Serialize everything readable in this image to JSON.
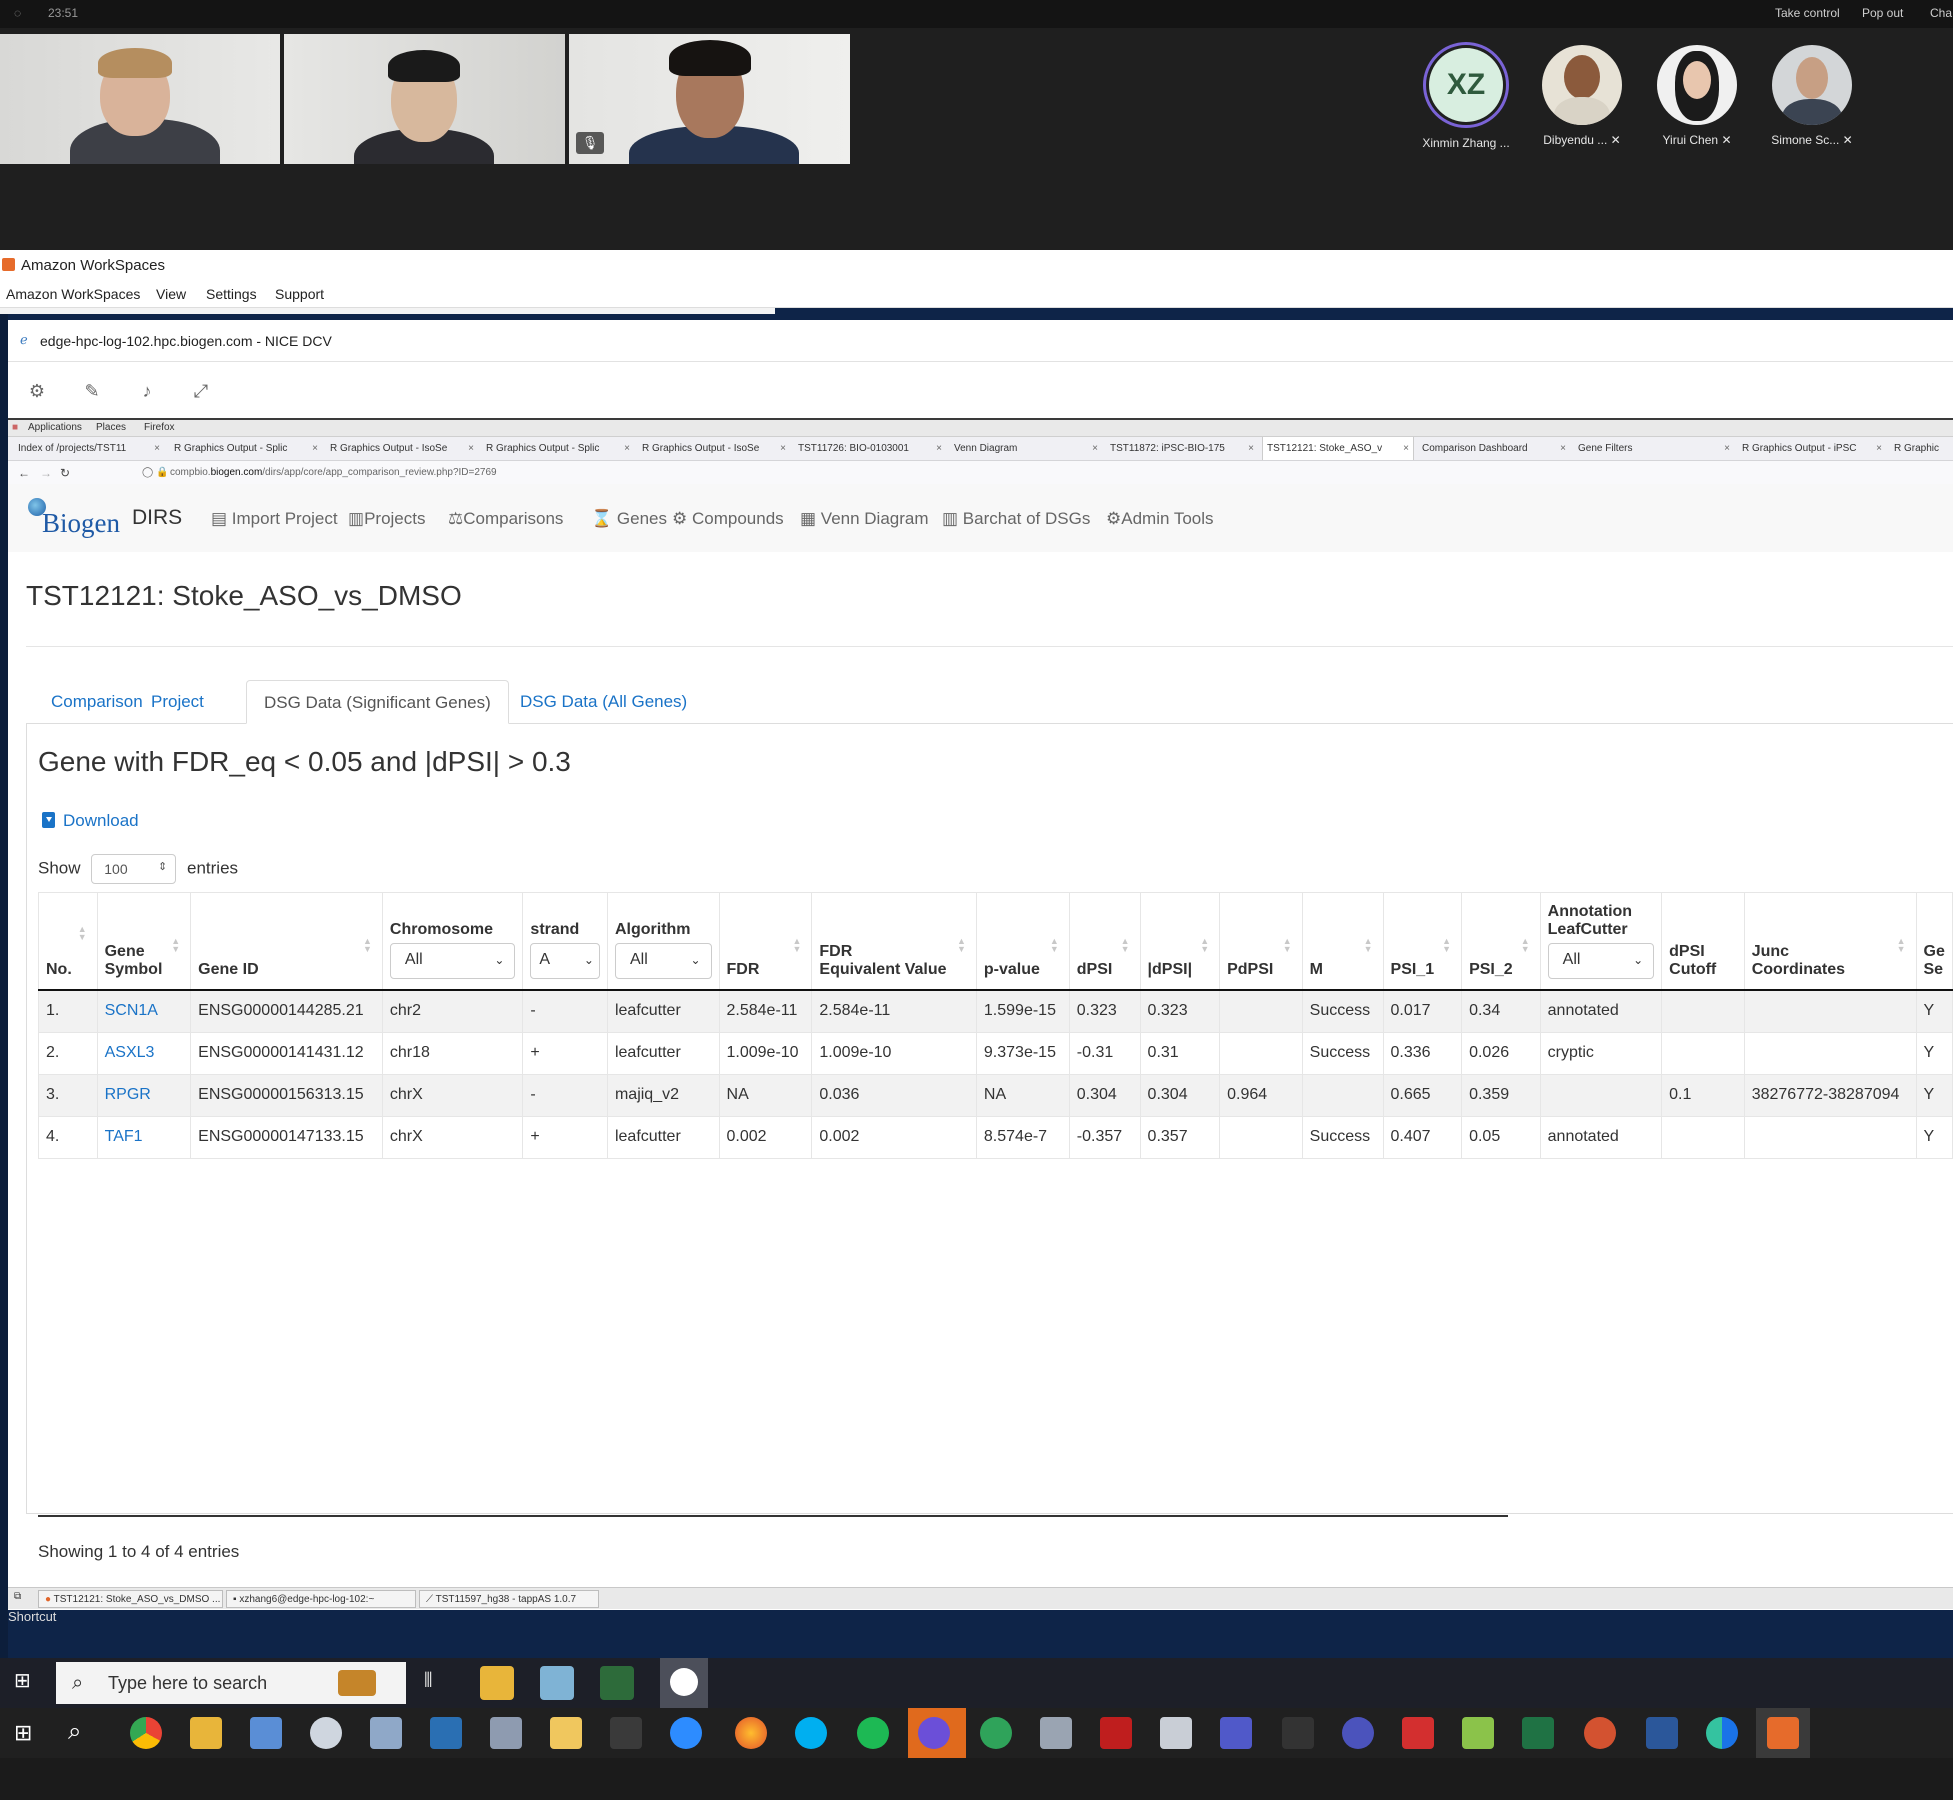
{
  "call": {
    "top_time": "23:51",
    "take_control": "Take control",
    "pop_out": "Pop out",
    "chat_partial": "Cha",
    "participants": [
      {
        "name": "Xinmin Zhang ...",
        "initials": "XZ",
        "muted": false
      },
      {
        "name": "Dibyendu ...",
        "muted": true
      },
      {
        "name": "Yirui Chen",
        "muted": true
      },
      {
        "name": "Simone Sc...",
        "muted": true
      }
    ]
  },
  "workspaces": {
    "title": "Amazon WorkSpaces",
    "menu": [
      "Amazon WorkSpaces",
      "View",
      "Settings",
      "Support"
    ]
  },
  "dcv": {
    "title": "edge-hpc-log-102.hpc.biogen.com - NICE DCV"
  },
  "gnome": {
    "items": [
      "Applications",
      "Places",
      "Firefox"
    ]
  },
  "browser": {
    "tabs": [
      {
        "label": "Index of /projects/TST11"
      },
      {
        "label": "R Graphics Output - Splic"
      },
      {
        "label": "R Graphics Output - IsoSe"
      },
      {
        "label": "R Graphics Output - Splic"
      },
      {
        "label": "R Graphics Output - IsoSe"
      },
      {
        "label": "TST11726: BIO-0103001"
      },
      {
        "label": "Venn Diagram"
      },
      {
        "label": "TST11872: iPSC-BIO-175"
      },
      {
        "label": "TST12121: Stoke_ASO_v"
      },
      {
        "label": "Comparison Dashboard"
      },
      {
        "label": "Gene Filters"
      },
      {
        "label": "R Graphics Output - iPSC"
      },
      {
        "label": "R Graphic"
      }
    ],
    "url_prefix": "compbio.",
    "url_domain": "biogen.com",
    "url_path": "/dirs/app/core/app_comparison_review.php?ID=2769"
  },
  "app": {
    "brand": "Biogen",
    "product": "DIRS",
    "nav": [
      "Import Project",
      "Projects",
      "Comparisons",
      "Genes",
      "Compounds",
      "Venn Diagram",
      "Barchat of DSGs",
      "Admin Tools"
    ],
    "page_title": "TST12121: Stoke_ASO_vs_DMSO",
    "tabs": [
      "Comparison",
      "Project",
      "DSG Data (Significant Genes)",
      "DSG Data (All Genes)"
    ],
    "subtitle": "Gene with FDR_eq < 0.05 and |dPSI| > 0.3",
    "download": "Download",
    "show_label": "Show",
    "show_value": "100",
    "entries_label": "entries",
    "info": "Showing 1 to 4 of 4 entries"
  },
  "table": {
    "headers": {
      "no": "No.",
      "gene_symbol_1": "Gene",
      "gene_symbol_2": "Symbol",
      "gene_id": "Gene ID",
      "chromosome": "Chromosome",
      "strand": "strand",
      "algorithm": "Algorithm",
      "fdr": "FDR",
      "fdr_eq_1": "FDR",
      "fdr_eq_2": "Equivalent Value",
      "pvalue": "p-value",
      "dpsi": "dPSI",
      "abs_dpsi": "|dPSI|",
      "pdpsi": "PdPSI",
      "m": "M",
      "psi1": "PSI_1",
      "psi2": "PSI_2",
      "annot_1": "Annotation",
      "annot_2": "LeafCutter",
      "cutoff_1": "dPSI",
      "cutoff_2": "Cutoff",
      "junc_1": "Junc",
      "junc_2": "Coordinates",
      "ge_1": "Ge",
      "ge_2": "Se"
    },
    "filters": {
      "chromosome": "All",
      "strand": "A",
      "algorithm": "All",
      "annotation": "All"
    },
    "rows": [
      {
        "no": "1.",
        "symbol": "SCN1A",
        "gene_id": "ENSG00000144285.21",
        "chrom": "chr2",
        "strand": "-",
        "algorithm": "leafcutter",
        "fdr": "2.584e-11",
        "fdr_eq": "2.584e-11",
        "pvalue": "1.599e-15",
        "dpsi": "0.323",
        "abs_dpsi": "0.323",
        "pdpsi": "",
        "m": "Success",
        "psi1": "0.017",
        "psi2": "0.34",
        "annot": "annotated",
        "cutoff": "",
        "junc": "",
        "ge": "Y"
      },
      {
        "no": "2.",
        "symbol": "ASXL3",
        "gene_id": "ENSG00000141431.12",
        "chrom": "chr18",
        "strand": "+",
        "algorithm": "leafcutter",
        "fdr": "1.009e-10",
        "fdr_eq": "1.009e-10",
        "pvalue": "9.373e-15",
        "dpsi": "-0.31",
        "abs_dpsi": "0.31",
        "pdpsi": "",
        "m": "Success",
        "psi1": "0.336",
        "psi2": "0.026",
        "annot": "cryptic",
        "cutoff": "",
        "junc": "",
        "ge": "Y"
      },
      {
        "no": "3.",
        "symbol": "RPGR",
        "gene_id": "ENSG00000156313.15",
        "chrom": "chrX",
        "strand": "-",
        "algorithm": "majiq_v2",
        "fdr": "NA",
        "fdr_eq": "0.036",
        "pvalue": "NA",
        "dpsi": "0.304",
        "abs_dpsi": "0.304",
        "pdpsi": "0.964",
        "m": "",
        "psi1": "0.665",
        "psi2": "0.359",
        "annot": "",
        "cutoff": "0.1",
        "junc": "38276772-38287094",
        "ge": "Y"
      },
      {
        "no": "4.",
        "symbol": "TAF1",
        "gene_id": "ENSG00000147133.15",
        "chrom": "chrX",
        "strand": "+",
        "algorithm": "leafcutter",
        "fdr": "0.002",
        "fdr_eq": "0.002",
        "pvalue": "8.574e-7",
        "dpsi": "-0.357",
        "abs_dpsi": "0.357",
        "pdpsi": "",
        "m": "Success",
        "psi1": "0.407",
        "psi2": "0.05",
        "annot": "annotated",
        "cutoff": "",
        "junc": "",
        "ge": "Y"
      }
    ]
  },
  "window_list": [
    "TST12121: Stoke_ASO_vs_DMSO ...",
    "xzhang6@edge-hpc-log-102:~",
    "TST11597_hg38 - tappAS 1.0.7"
  ],
  "desktop": {
    "shortcut_label": "Shortcut"
  },
  "taskbar": {
    "search_placeholder": "Type here to search"
  }
}
